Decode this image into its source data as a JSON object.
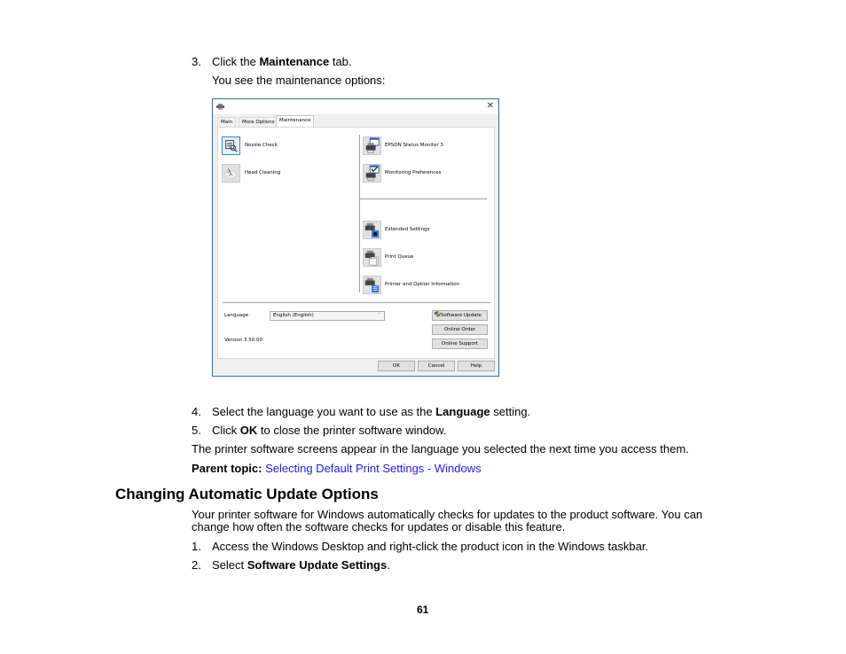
{
  "steps_top": [
    {
      "num": "3.",
      "pre": "Click the ",
      "bold": "Maintenance",
      "post": " tab."
    }
  ],
  "step3_sub": "You see the maintenance options:",
  "dialog": {
    "close_glyph": "✕",
    "tabs": [
      {
        "label": "Main",
        "active": false
      },
      {
        "label": "More Options",
        "active": false
      },
      {
        "label": "Maintenance",
        "active": true
      }
    ],
    "left_items": [
      {
        "label": "Nozzle Check",
        "icon": "nozzle-check-icon"
      },
      {
        "label": "Head Cleaning",
        "icon": "head-cleaning-icon"
      }
    ],
    "right_items_top": [
      {
        "label": "EPSON Status Monitor 3",
        "icon": "status-monitor-icon"
      },
      {
        "label": "Monitoring Preferences",
        "icon": "monitoring-preferences-icon"
      }
    ],
    "right_items_bottom": [
      {
        "label": "Extended Settings",
        "icon": "extended-settings-icon"
      },
      {
        "label": "Print Queue",
        "icon": "print-queue-icon"
      },
      {
        "label": "Printer and Option Information",
        "icon": "printer-info-icon"
      }
    ],
    "language_label": "Language",
    "language_value": "English (English)",
    "chevron_glyph": "˅",
    "version": "Version 3.50.00",
    "software_update": "Software Update",
    "online_order": "Online Order",
    "online_support": "Online Support",
    "ok": "OK",
    "cancel": "Cancel",
    "help": "Help"
  },
  "steps_mid": [
    {
      "num": "4.",
      "pre": "Select the language you want to use as the ",
      "bold": "Language",
      "post": " setting."
    },
    {
      "num": "5.",
      "pre": "Click ",
      "bold": "OK",
      "post": " to close the printer software window."
    }
  ],
  "result_text": "The printer software screens appear in the language you selected the next time you access them.",
  "parent_topic_label": "Parent topic:",
  "parent_topic_link": "Selecting Default Print Settings - Windows",
  "colors": {
    "link": "#1a1aff",
    "dialog_border": "#2b6cb0"
  },
  "section_heading": "Changing Automatic Update Options",
  "section_intro": "Your printer software for Windows automatically checks for updates to the product software. You can change how often the software checks for updates or disable this feature.",
  "steps_bottom": [
    {
      "num": "1.",
      "pre": "Access the Windows Desktop and right-click the product icon in the Windows taskbar.",
      "bold": "",
      "post": ""
    },
    {
      "num": "2.",
      "pre": "Select ",
      "bold": "Software Update Settings",
      "post": "."
    }
  ],
  "page_number": "61"
}
